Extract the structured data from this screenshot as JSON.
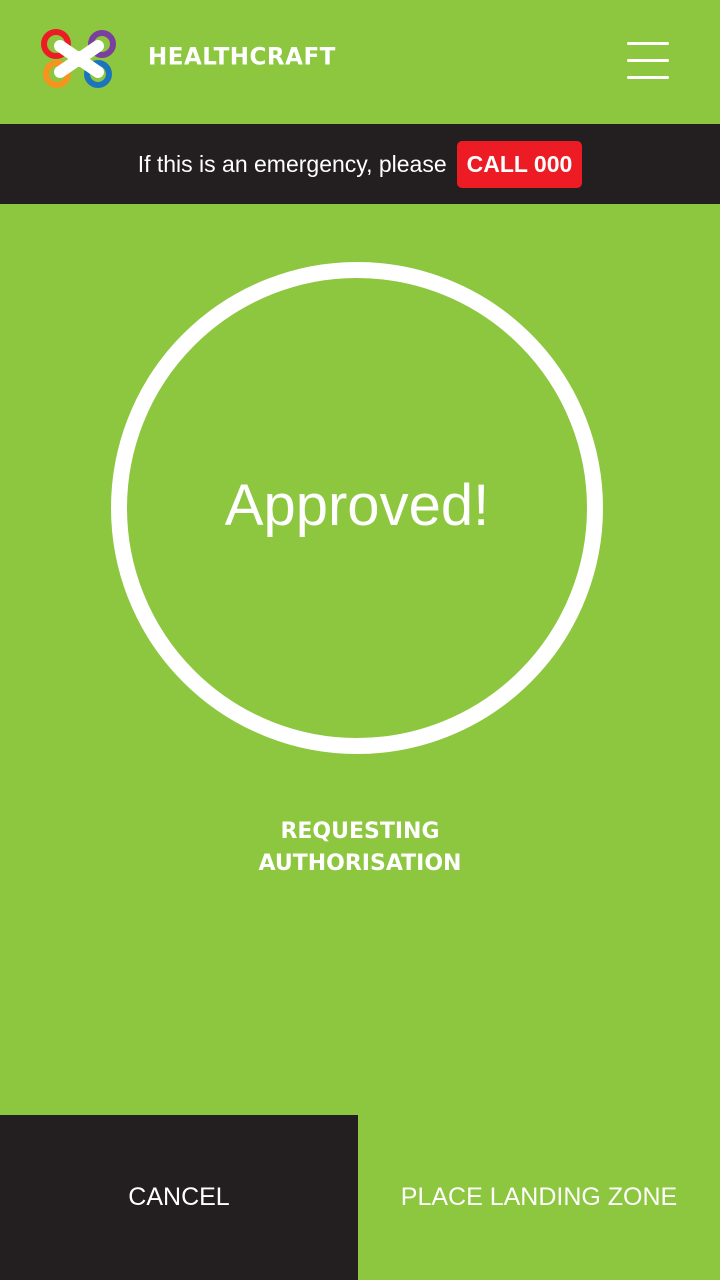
{
  "header": {
    "brand": "HEALTHCRAFT",
    "logo_icon": "healthcraft-drone-logo-icon",
    "menu_icon": "hamburger-menu-icon"
  },
  "emergency": {
    "text": "If this is an emergency, please",
    "call_label": "CALL 000"
  },
  "status": {
    "main": "Approved!",
    "sub_line1": "REQUESTING",
    "sub_line2": "AUTHORISATION"
  },
  "actions": {
    "cancel_label": "CANCEL",
    "place_label": "PLACE LANDING ZONE"
  },
  "colors": {
    "background": "#8dc63f",
    "dark": "#231f20",
    "emergency_red": "#ed1c24",
    "text": "#ffffff"
  }
}
